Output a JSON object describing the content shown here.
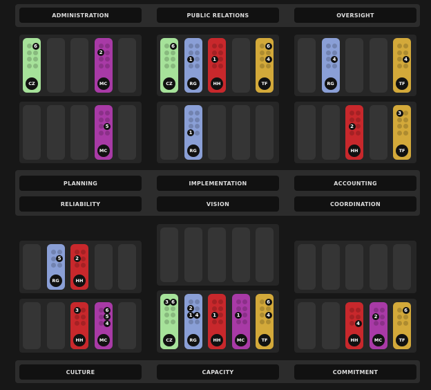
{
  "colors": {
    "CZ": "#a6e29a",
    "RG": "#8a9fd6",
    "HH": "#c8282c",
    "MC": "#a83aa6",
    "TF": "#d3a93a"
  },
  "labels": [
    "Administration",
    "Public Relations",
    "Oversight",
    "Planning",
    "Implementation",
    "Accounting",
    "Reliability",
    "Vision",
    "Coordination",
    "Culture",
    "Capacity",
    "Commitment"
  ],
  "panels": [
    {
      "cards": [
        {
          "slot": 0,
          "team": "CZ",
          "nums": [
            {
              "p": 1,
              "v": "6"
            }
          ]
        },
        {
          "slot": 3,
          "team": "MC",
          "nums": [
            {
              "p": 2,
              "v": "2"
            }
          ]
        }
      ]
    },
    {
      "cards": [
        {
          "slot": 0,
          "team": "CZ",
          "nums": [
            {
              "p": 1,
              "v": "6"
            }
          ]
        },
        {
          "slot": 1,
          "team": "RG",
          "nums": [
            {
              "p": 4,
              "v": "1"
            }
          ]
        },
        {
          "slot": 2,
          "team": "HH",
          "nums": [
            {
              "p": 4,
              "v": "1"
            }
          ]
        },
        {
          "slot": 4,
          "team": "TF",
          "nums": [
            {
              "p": 1,
              "v": "6"
            },
            {
              "p": 5,
              "v": "4"
            }
          ]
        }
      ]
    },
    {
      "cards": [
        {
          "slot": 1,
          "team": "RG",
          "nums": [
            {
              "p": 5,
              "v": "4"
            }
          ]
        },
        {
          "slot": 4,
          "team": "TF",
          "nums": [
            {
              "p": 5,
              "v": "4"
            }
          ]
        }
      ]
    },
    {
      "cards": [
        {
          "slot": 3,
          "team": "MC",
          "nums": [
            {
              "p": 5,
              "v": "5"
            }
          ]
        }
      ]
    },
    {
      "cards": [
        {
          "slot": 1,
          "team": "RG",
          "nums": [
            {
              "p": 6,
              "v": "1"
            }
          ]
        }
      ]
    },
    {
      "cards": [
        {
          "slot": 2,
          "team": "HH",
          "nums": [
            {
              "p": 4,
              "v": "2"
            }
          ]
        },
        {
          "slot": 4,
          "team": "TF",
          "nums": [
            {
              "p": 0,
              "v": "3"
            }
          ]
        }
      ]
    },
    {
      "cards": [
        {
          "slot": 1,
          "team": "RG",
          "nums": [
            {
              "p": 3,
              "v": "5"
            }
          ]
        },
        {
          "slot": 2,
          "team": "HH",
          "nums": [
            {
              "p": 2,
              "v": "2"
            }
          ]
        }
      ]
    },
    {
      "cards": []
    },
    {
      "cards": []
    },
    {
      "cards": [
        {
          "slot": 2,
          "team": "HH",
          "nums": [
            {
              "p": 0,
              "v": "3"
            }
          ]
        },
        {
          "slot": 3,
          "team": "MC",
          "nums": [
            {
              "p": 1,
              "v": "6"
            },
            {
              "p": 3,
              "v": "5"
            },
            {
              "p": 5,
              "v": "4"
            }
          ]
        }
      ]
    },
    {
      "cards": [
        {
          "slot": 0,
          "team": "CZ",
          "nums": [
            {
              "p": 0,
              "v": "3"
            },
            {
              "p": 1,
              "v": "6"
            }
          ]
        },
        {
          "slot": 1,
          "team": "RG",
          "nums": [
            {
              "p": 2,
              "v": "2"
            },
            {
              "p": 4,
              "v": "1"
            },
            {
              "p": 5,
              "v": "4"
            }
          ]
        },
        {
          "slot": 2,
          "team": "HH",
          "nums": [
            {
              "p": 4,
              "v": "1"
            }
          ]
        },
        {
          "slot": 3,
          "team": "MC",
          "nums": [
            {
              "p": 4,
              "v": "1"
            }
          ]
        },
        {
          "slot": 4,
          "team": "TF",
          "nums": [
            {
              "p": 1,
              "v": "6"
            },
            {
              "p": 5,
              "v": "4"
            }
          ]
        }
      ]
    },
    {
      "cards": [
        {
          "slot": 2,
          "team": "HH",
          "nums": [
            {
              "p": 5,
              "v": "4"
            }
          ]
        },
        {
          "slot": 3,
          "team": "MC",
          "nums": [
            {
              "p": 2,
              "v": "2"
            }
          ]
        },
        {
          "slot": 4,
          "team": "TF",
          "nums": [
            {
              "p": 1,
              "v": "6"
            }
          ]
        }
      ]
    }
  ]
}
